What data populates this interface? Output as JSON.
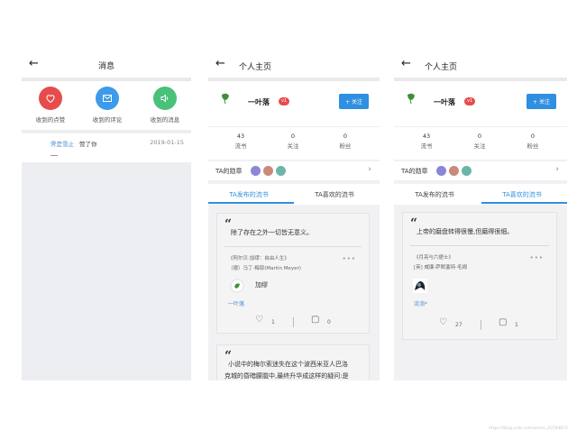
{
  "screen1": {
    "title": "消息",
    "actions": [
      {
        "label": "收到的点赞",
        "icon": "heart-icon",
        "color": "#e74c4c"
      },
      {
        "label": "收到的评论",
        "icon": "mail-icon",
        "color": "#3d9be9"
      },
      {
        "label": "收到的消息",
        "icon": "speaker-icon",
        "color": "#49c17a"
      }
    ],
    "message": {
      "user": "霁是雪止",
      "text": "赞了你",
      "date": "2019-01-15"
    }
  },
  "profile": {
    "header_title": "个人主页",
    "name": "一叶落",
    "level": "v1",
    "follow_label": "+ 关注",
    "stats": [
      {
        "value": "43",
        "label": "流书"
      },
      {
        "value": "0",
        "label": "关注"
      },
      {
        "value": "0",
        "label": "粉丝"
      }
    ],
    "badges_label": "TA的勋章",
    "tabs": [
      "TA发布的流书",
      "TA喜欢的流书"
    ],
    "colors": {
      "accent": "#2f8fe0",
      "level_badge": "#e74c4c"
    }
  },
  "screen2": {
    "card1": {
      "quote": "除了存在之外一切皆无意义。",
      "source_line1": "《阿尔贝·加缪：自由人生》",
      "source_line2": "（德）马丁·梅耶(Martin Meyer)",
      "author_name": "加缪",
      "poster": "一叶落",
      "likes": "1",
      "comments": "0"
    },
    "card2": {
      "quote_line1": "小说中的梅尔索迷失在这个波西米亚人巴洛",
      "quote_line2": "克城的昏暗朦胧中,最终升华成这样的疑问:是"
    }
  },
  "screen3": {
    "card": {
      "quote": "上帝的磨盘转得很慢,但磨得很细。",
      "source_line1": "《月亮与六便士》",
      "source_line2": "[英] 威廉·萨默塞特·毛姆",
      "poster": "流淌*",
      "likes": "27",
      "comments": "1"
    }
  },
  "watermark": "https://blog.csdn.net/weixin_43784872"
}
